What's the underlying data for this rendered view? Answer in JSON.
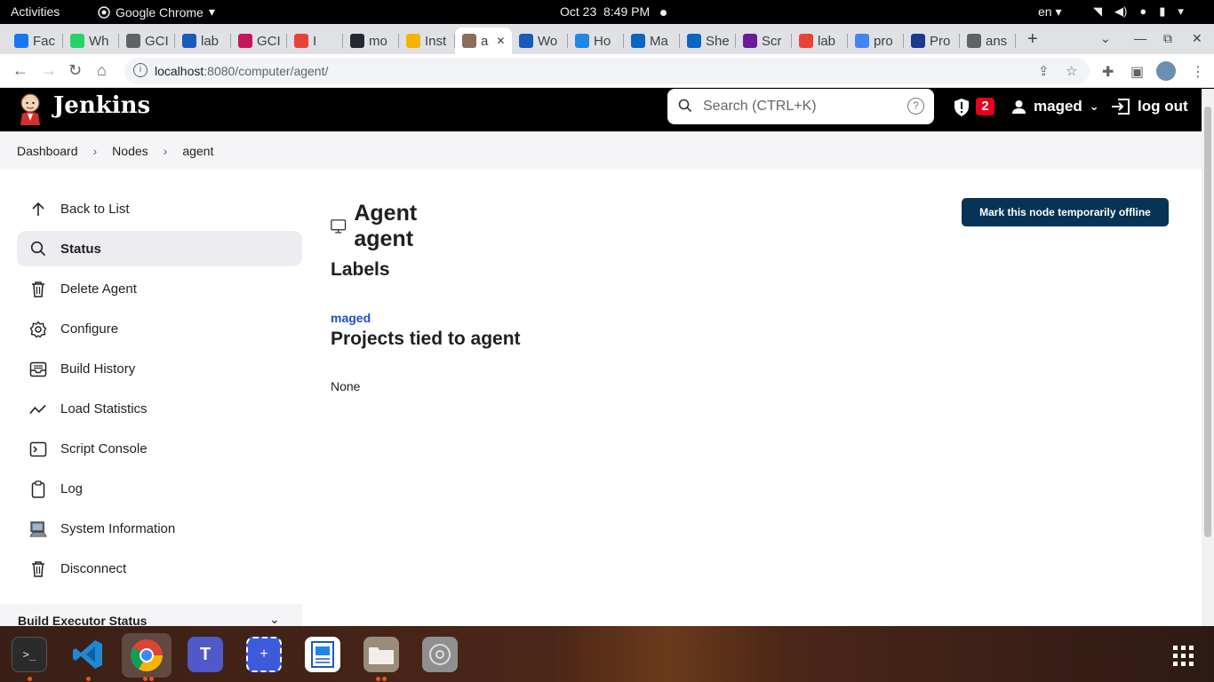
{
  "system_bar": {
    "activities": "Activities",
    "app_name": "Google Chrome",
    "date": "Oct 23",
    "time": "8:49 PM",
    "lang": "en"
  },
  "browser": {
    "tabs": [
      {
        "label": "Fac",
        "color": "#1877f2"
      },
      {
        "label": "Wh",
        "color": "#25d366"
      },
      {
        "label": "GCI",
        "color": "#5f6368"
      },
      {
        "label": "lab",
        "color": "#185abd"
      },
      {
        "label": "GCI",
        "color": "#c2185b"
      },
      {
        "label": "I",
        "color": "#ea4335"
      },
      {
        "label": "mo",
        "color": "#24292f"
      },
      {
        "label": "Inst",
        "color": "#f5b400"
      },
      {
        "label": "a",
        "color": "#8a6d5a",
        "active": true
      },
      {
        "label": "Wo",
        "color": "#185abd"
      },
      {
        "label": "Ho",
        "color": "#1e88e5"
      },
      {
        "label": "Ma",
        "color": "#0a66c2"
      },
      {
        "label": "She",
        "color": "#0a66c2"
      },
      {
        "label": "Scr",
        "color": "#6a1b9a"
      },
      {
        "label": "lab",
        "color": "#ea4335"
      },
      {
        "label": "pro",
        "color": "#4285f4"
      },
      {
        "label": "Pro",
        "color": "#1a3a8f"
      },
      {
        "label": "ans",
        "color": "#5f6368"
      }
    ],
    "url_host": "localhost",
    "url_path": ":8080/computer/agent/"
  },
  "jenkins": {
    "brand": "Jenkins",
    "search_placeholder": "Search (CTRL+K)",
    "help": "?",
    "alerts_count": "2",
    "username": "maged",
    "logout": "log out"
  },
  "breadcrumbs": [
    "Dashboard",
    "Nodes",
    "agent"
  ],
  "sidebar": {
    "items": [
      {
        "label": "Back to List",
        "icon": "arrow-up-icon"
      },
      {
        "label": "Status",
        "icon": "search-icon",
        "active": true
      },
      {
        "label": "Delete Agent",
        "icon": "trash-icon"
      },
      {
        "label": "Configure",
        "icon": "gear-icon"
      },
      {
        "label": "Build History",
        "icon": "inbox-icon"
      },
      {
        "label": "Load Statistics",
        "icon": "trend-icon"
      },
      {
        "label": "Script Console",
        "icon": "terminal-icon"
      },
      {
        "label": "Log",
        "icon": "clipboard-icon"
      },
      {
        "label": "System Information",
        "icon": "computer-icon"
      },
      {
        "label": "Disconnect",
        "icon": "trash-icon"
      }
    ],
    "executor_status": "Build Executor Status"
  },
  "main": {
    "title": "Agent agent",
    "offline_button": "Mark this node temporarily offline",
    "labels_heading": "Labels",
    "label_link": "maged",
    "projects_heading": "Projects tied to agent",
    "projects_value": "None"
  }
}
